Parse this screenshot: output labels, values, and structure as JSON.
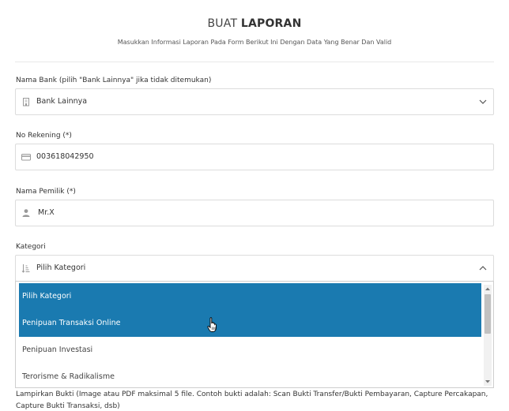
{
  "header": {
    "title_light": "BUAT ",
    "title_bold": "LAPORAN",
    "subtitle": "Masukkan Informasi Laporan Pada Form Berikut Ini Dengan Data Yang Benar Dan Valid"
  },
  "bank": {
    "label": "Nama Bank (pilih \"Bank Lainnya\" jika tidak ditemukan)",
    "value": "Bank Lainnya",
    "icon": "bank-icon"
  },
  "account": {
    "label": "No Rekening (*)",
    "value": "003618042950",
    "icon": "credit-card-icon"
  },
  "owner": {
    "label": "Nama Pemilik (*)",
    "value": "Mr.X",
    "icon": "user-icon"
  },
  "category": {
    "label": "Kategori",
    "value": "Pilih Kategori",
    "icon": "sort-icon",
    "options": [
      {
        "label": "Pilih Kategori",
        "state": "selected"
      },
      {
        "label": "Penipuan Transaksi Online",
        "state": "hover"
      },
      {
        "label": "Penipuan Investasi",
        "state": "normal"
      },
      {
        "label": "Terorisme & Radikalisme",
        "state": "normal"
      }
    ]
  },
  "evidence": {
    "label": "Lampirkan Bukti (Image atau PDF maksimal 5 file. Contoh bukti adalah: Scan Bukti Transfer/Bukti Pembayaran, Capture Percakapan, Capture Bukti Transaksi, dsb)"
  },
  "colors": {
    "highlight": "#1a7ab0",
    "border": "#dcdcdc"
  }
}
